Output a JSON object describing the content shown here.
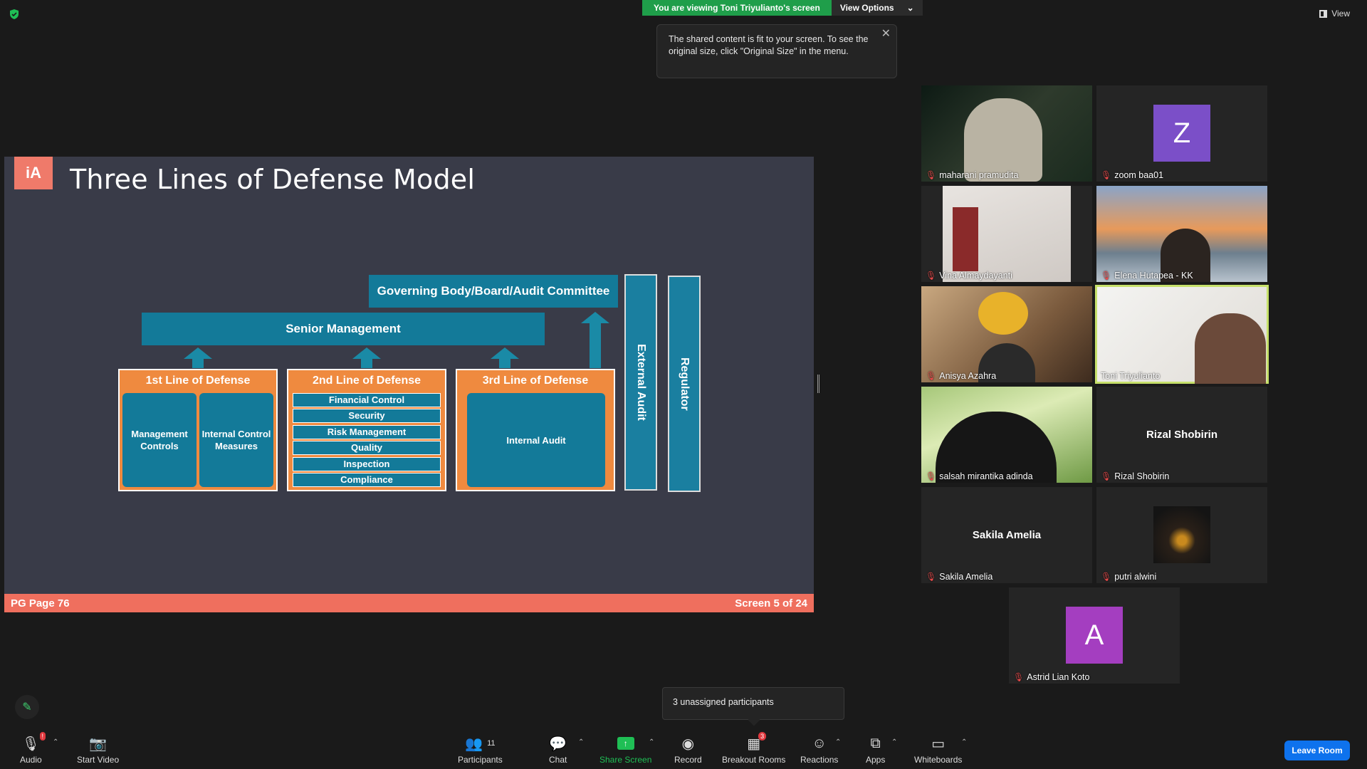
{
  "top": {
    "viewing_text": "You are viewing Toni Triyulianto's screen",
    "view_options": "View Options",
    "tooltip": "The shared content is fit to your screen. To see the original size, click \"Original Size\" in the menu.",
    "view_label": "View"
  },
  "slide": {
    "title": "Three Lines of Defense Model",
    "governing": "Governing Body/Board/Audit Committee",
    "senior": "Senior Management",
    "external_audit": "External Audit",
    "regulator": "Regulator",
    "line1": {
      "header": "1st Line of Defense",
      "box1": "Management Controls",
      "box2": "Internal Control Measures"
    },
    "line2": {
      "header": "2nd Line of Defense",
      "items": [
        "Financial Control",
        "Security",
        "Risk Management",
        "Quality",
        "Inspection",
        "Compliance"
      ]
    },
    "line3": {
      "header": "3rd Line of Defense",
      "box": "Internal Audit"
    },
    "footer_left": "PG Page 76",
    "footer_right": "Screen 5 of 24",
    "colors": {
      "teal": "#137a99",
      "orange": "#ef8a3f",
      "coral": "#ef6f5e",
      "slate": "#393b48"
    }
  },
  "participants": [
    {
      "name": "maharani pramudita"
    },
    {
      "name": "zoom baa01",
      "initial": "Z",
      "color": "#7b4fc8"
    },
    {
      "name": "Vina Almaydayanti"
    },
    {
      "name": "Elena Hutapea - KK"
    },
    {
      "name": "Anisya Azahra"
    },
    {
      "name": "Toni Triyulianto"
    },
    {
      "name": "salsah mirantika adinda"
    },
    {
      "name": "Rizal Shobirin",
      "display": "Rizal Shobirin"
    },
    {
      "name": "Sakila Amelia",
      "display": "Sakila Amelia"
    },
    {
      "name": "putri alwini"
    },
    {
      "name": "Astrid Lian Koto",
      "initial": "A",
      "color": "#a43ec0"
    }
  ],
  "unassigned": "3 unassigned participants",
  "toolbar": {
    "audio": "Audio",
    "start_video": "Start Video",
    "participants": "Participants",
    "participants_count": "11",
    "chat": "Chat",
    "share_screen": "Share Screen",
    "record": "Record",
    "breakout_rooms": "Breakout Rooms",
    "breakout_count": "3",
    "reactions": "Reactions",
    "apps": "Apps",
    "whiteboards": "Whiteboards",
    "leave": "Leave Room",
    "audio_badge": "!"
  }
}
